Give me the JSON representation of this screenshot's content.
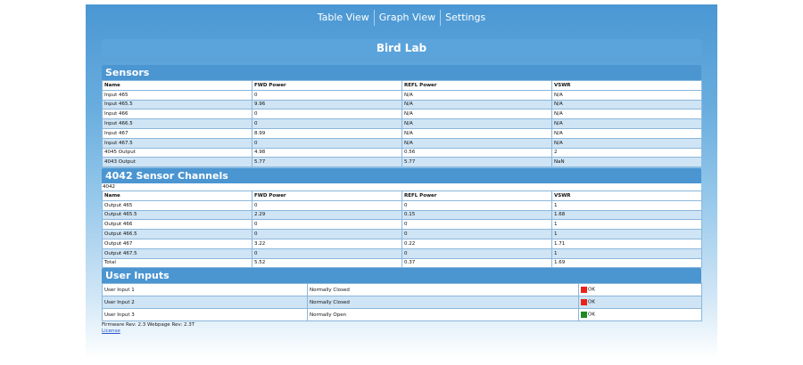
{
  "nav": {
    "items": [
      "Table View",
      "Graph View",
      "Settings"
    ]
  },
  "title": "Bird Lab",
  "sensors": {
    "header": "Sensors",
    "columns": [
      "Name",
      "FWD Power",
      "REFL Power",
      "VSWR"
    ],
    "rows": [
      [
        "Input 465",
        "0",
        "N/A",
        "N/A"
      ],
      [
        "Input 465.5",
        "9.96",
        "N/A",
        "N/A"
      ],
      [
        "Input 466",
        "0",
        "N/A",
        "N/A"
      ],
      [
        "Input 466.5",
        "0",
        "N/A",
        "N/A"
      ],
      [
        "Input 467",
        "8.99",
        "N/A",
        "N/A"
      ],
      [
        "Input 467.5",
        "0",
        "N/A",
        "N/A"
      ],
      [
        "4045 Output",
        "4.98",
        "0.56",
        "2"
      ],
      [
        "4043 Output",
        "5.77",
        "5.77",
        "NaN"
      ]
    ]
  },
  "channels": {
    "header": "4042 Sensor Channels",
    "sublabel": "4042",
    "columns": [
      "Name",
      "FWD Power",
      "REFL Power",
      "VSWR"
    ],
    "rows": [
      [
        "Output 465",
        "0",
        "0",
        "1"
      ],
      [
        "Output 465.5",
        "2.29",
        "0.15",
        "1.68"
      ],
      [
        "Output 466",
        "0",
        "0",
        "1"
      ],
      [
        "Output 466.5",
        "0",
        "0",
        "1"
      ],
      [
        "Output 467",
        "3.22",
        "0.22",
        "1.71"
      ],
      [
        "Output 467.5",
        "0",
        "0",
        "1"
      ],
      [
        "Total",
        "5.52",
        "0.37",
        "1.69"
      ]
    ]
  },
  "user_inputs": {
    "header": "User Inputs",
    "rows": [
      {
        "name": "User Input 1",
        "mode": "Normally Closed",
        "status": "OK",
        "color": "#e8231b"
      },
      {
        "name": "User Input 2",
        "mode": "Normally Closed",
        "status": "OK",
        "color": "#e8231b"
      },
      {
        "name": "User Input 3",
        "mode": "Normally Open",
        "status": "OK",
        "color": "#1f8a23"
      }
    ]
  },
  "footer": {
    "revision": "Firmware Rev: 2.3 Webpage Rev: 2.3T",
    "license_link": "License"
  }
}
